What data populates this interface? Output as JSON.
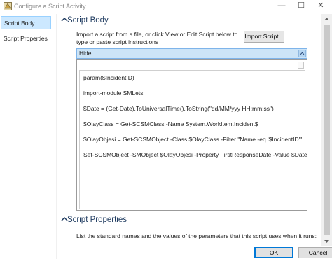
{
  "window": {
    "title": "Configure a Script Activity",
    "minimize_glyph": "—",
    "maximize_glyph": "☐",
    "close_glyph": "✕"
  },
  "sidebar": {
    "items": [
      {
        "label": "Script Body",
        "selected": true
      },
      {
        "label": "Script Properties",
        "selected": false
      }
    ]
  },
  "script_body": {
    "section_title": "Script Body",
    "description": "Import a script from a file, or click View or Edit Script below to type or paste script instructions",
    "import_button": "Import Script...",
    "hide_label": "Hide",
    "script_lines": [
      "param($IncidentID)",
      "import-module SMLets",
      "$Date = (Get-Date).ToUniversalTime().ToString(\"dd/MM/yyy HH:mm:ss\")",
      "$OlayClass = Get-SCSMClass -Name System.WorkItem.Incident$",
      "$OlayObjesi = Get-SCSMObject -Class $OlayClass -Filter \"Name -eq '$IncidentID'\"",
      "Set-SCSMObject -SMObject $OlayObjesi -Property FirstResponseDate -Value $Date"
    ]
  },
  "script_properties": {
    "section_title": "Script Properties",
    "description": "List the standard names and the values of the parameters that this script uses when it runs:"
  },
  "footer": {
    "ok_label": "OK",
    "cancel_label": "Cancel"
  },
  "colors": {
    "selection": "#cce8ff",
    "accent": "#0078d7",
    "section_title": "#1e3a5f"
  },
  "icons": [
    "app-icon",
    "chevron-up-icon",
    "scroll-up-icon",
    "scroll-down-icon"
  ]
}
